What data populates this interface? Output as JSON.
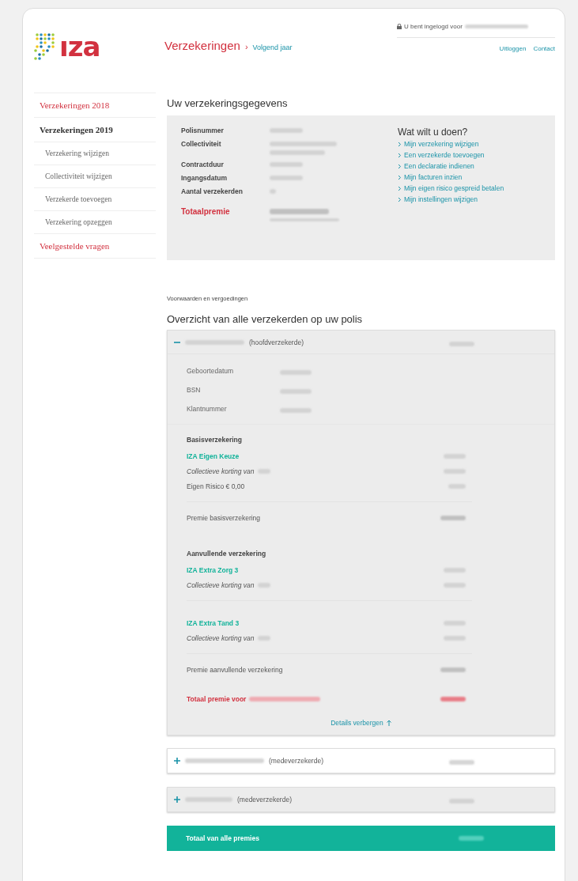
{
  "header": {
    "logo_text": "ıza",
    "breadcrumb": {
      "section": "Verzekeringen",
      "separator": "›",
      "current": "Volgend jaar"
    },
    "login_text": "U bent ingelogd voor",
    "links": [
      "Uitloggen",
      "Contact"
    ]
  },
  "sidebar": {
    "items": [
      {
        "label": "Verzekeringen 2018",
        "kind": "section",
        "selected": false
      },
      {
        "label": "Verzekeringen 2019",
        "kind": "section",
        "selected": true
      },
      {
        "label": "Verzekering wijzigen",
        "kind": "sub",
        "selected": false
      },
      {
        "label": "Collectiviteit wijzigen",
        "kind": "sub",
        "selected": false
      },
      {
        "label": "Verzekerde toevoegen",
        "kind": "sub",
        "selected": false
      },
      {
        "label": "Verzekering opzeggen",
        "kind": "sub",
        "selected": false
      },
      {
        "label": "Veelgestelde vragen",
        "kind": "section",
        "selected": false
      }
    ]
  },
  "policy": {
    "title": "Uw verzekeringsgegevens",
    "fields": [
      {
        "label": "Polisnummer",
        "kind": "single"
      },
      {
        "label": "Collectiviteit",
        "kind": "double"
      },
      {
        "label": "Contractduur",
        "kind": "single"
      },
      {
        "label": "Ingangsdatum",
        "kind": "single"
      },
      {
        "label": "Aantal verzekerden",
        "kind": "short"
      },
      {
        "label": "Totaalpremie",
        "kind": "total"
      }
    ],
    "actions_title": "Wat wilt u doen?",
    "actions": [
      "Mijn verzekering wijzigen",
      "Een verzekerde toevoegen",
      "Een declaratie indienen",
      "Mijn facturen inzien",
      "Mijn eigen risico gespreid betalen",
      "Mijn instellingen wijzigen"
    ]
  },
  "terms_link": "Voorwaarden en vergoedingen",
  "overview": {
    "title": "Overzicht van alle verzekerden op uw polis",
    "insured": [
      {
        "role": "(hoofdverzekerde)",
        "expanded": true,
        "highlighted": true,
        "personal": [
          "Geboortedatum",
          "BSN",
          "Klantnummer"
        ],
        "sections": [
          {
            "title": "Basisverzekering",
            "products": [
              {
                "name": "IZA Eigen Keuze",
                "lines": [
                  {
                    "kind": "discount",
                    "label": "Collectieve korting van"
                  },
                  {
                    "kind": "plain",
                    "label": "Eigen Risico € 0,00"
                  }
                ]
              }
            ],
            "subtotal": "Premie basisverzekering"
          },
          {
            "title": "Aanvullende verzekering",
            "products": [
              {
                "name": "IZA Extra Zorg 3",
                "lines": [
                  {
                    "kind": "discount",
                    "label": "Collectieve korting van"
                  }
                ]
              },
              {
                "name": "IZA Extra Tand 3",
                "lines": [
                  {
                    "kind": "discount",
                    "label": "Collectieve korting van"
                  }
                ]
              }
            ],
            "subtotal": "Premie aanvullende verzekering"
          }
        ],
        "total_label": "Totaal premie voor",
        "toggle_label": "Details verbergen"
      },
      {
        "role": "(medeverzekerde)",
        "expanded": false,
        "highlighted": false
      },
      {
        "role": "(medeverzekerde)",
        "expanded": false,
        "highlighted": true
      }
    ],
    "grand_total": "Totaal van alle premies"
  }
}
